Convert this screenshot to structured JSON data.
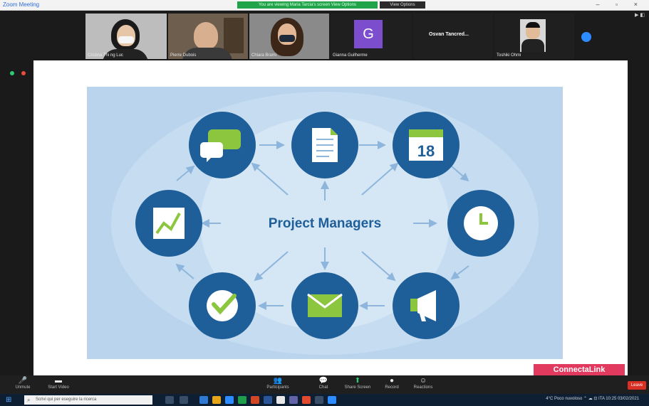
{
  "window": {
    "app_name": "Zoom Meeting",
    "banner_text": "You are viewing Maria Tarcia's screen   View Options",
    "view_options": "View Options",
    "window_controls": "–  ▫  ×"
  },
  "participants": [
    {
      "name": "Cristina Thi ng Luc",
      "kind": "video",
      "skin": "#e7c6a8",
      "bg": "#bfbfbf",
      "hair": "#1a1a1a"
    },
    {
      "name": "Pierre Dubois",
      "kind": "video",
      "skin": "#d9b08f",
      "bg": "#7a6a5a",
      "hair": "#b08060"
    },
    {
      "name": "Chiara Brami",
      "kind": "video",
      "skin": "#e3b795",
      "bg": "#8e8e8e",
      "hair": "#3b2618"
    },
    {
      "name": "Gianna Guilherme",
      "kind": "avatar",
      "initial": "G"
    },
    {
      "name": "",
      "kind": "text",
      "title": "Osvan Tancred..."
    },
    {
      "name": "Toshiki Ohmi",
      "kind": "video",
      "skin": "#e2bb98",
      "bg": "#d8d8d8",
      "hair": "#111111"
    }
  ],
  "hide_self_label": "▶ ◧",
  "slide": {
    "center_text": "Project Managers",
    "calendar_day": "18",
    "nodes": [
      "chat-bubbles-icon",
      "document-icon",
      "calendar-icon",
      "chart-icon",
      "clock-icon",
      "checkmark-icon",
      "envelope-icon",
      "megaphone-icon"
    ],
    "colors": {
      "circle": "#1f5f99",
      "green": "#8cc63f",
      "light_bg": "#b9d4ec",
      "arrow": "#8eb6dc",
      "center_text": "#1f5f99"
    }
  },
  "brand_label": "ConnectaLink",
  "toolbar": {
    "items": [
      {
        "label": "Unmute",
        "glyph": "🎤"
      },
      {
        "label": "Start Video",
        "glyph": "▬"
      },
      {
        "label": "Participants",
        "glyph": "👥"
      },
      {
        "label": "Chat",
        "glyph": "💬"
      },
      {
        "label": "Share Screen",
        "glyph": "⬆"
      },
      {
        "label": "Record",
        "glyph": "●"
      },
      {
        "label": "Reactions",
        "glyph": "☺"
      }
    ],
    "end_label": "Leave"
  },
  "taskbar": {
    "search_placeholder": "Scrivi qui per eseguire la ricerca",
    "tray_text": "4°C Poco nuvoloso  ⌃ ☁ ⊡ ITA  10:25  03/02/2021"
  }
}
